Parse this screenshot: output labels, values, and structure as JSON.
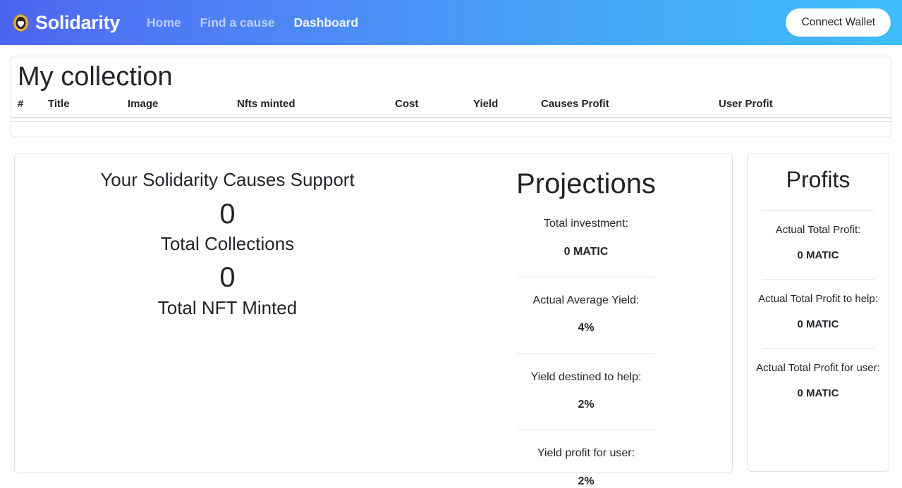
{
  "navbar": {
    "brand": "Solidarity",
    "logo_icon": "heart-coin-icon",
    "links": [
      {
        "label": "Home",
        "active": false
      },
      {
        "label": "Find a cause",
        "active": false
      },
      {
        "label": "Dashboard",
        "active": true
      }
    ],
    "connect_wallet_label": "Connect Wallet",
    "gradient_start": "#4a64f0",
    "gradient_end": "#3fbdfb"
  },
  "collection": {
    "title": "My collection",
    "columns": [
      "#",
      "Title",
      "Image",
      "Nfts minted",
      "Cost",
      "Yield",
      "Causes Profit",
      "User Profit"
    ],
    "rows": []
  },
  "support": {
    "heading": "Your Solidarity Causes Support",
    "total_collections_value": "0",
    "total_collections_label": "Total Collections",
    "total_nft_minted_value": "0",
    "total_nft_minted_label": "Total NFT Minted"
  },
  "projections": {
    "title": "Projections",
    "stats": [
      {
        "label": "Total investment:",
        "value": "0 MATIC"
      },
      {
        "label": "Actual Average Yield:",
        "value": "4%"
      },
      {
        "label": "Yield destined to help:",
        "value": "2%"
      },
      {
        "label": "Yield profit for user:",
        "value": "2%"
      }
    ]
  },
  "profits": {
    "title": "Profits",
    "stats": [
      {
        "label": "Actual Total Profit:",
        "value": "0 MATIC"
      },
      {
        "label": "Actual Total Profit to help:",
        "value": "0 MATIC"
      },
      {
        "label": "Actual Total Profit for user:",
        "value": "0 MATIC"
      }
    ]
  }
}
